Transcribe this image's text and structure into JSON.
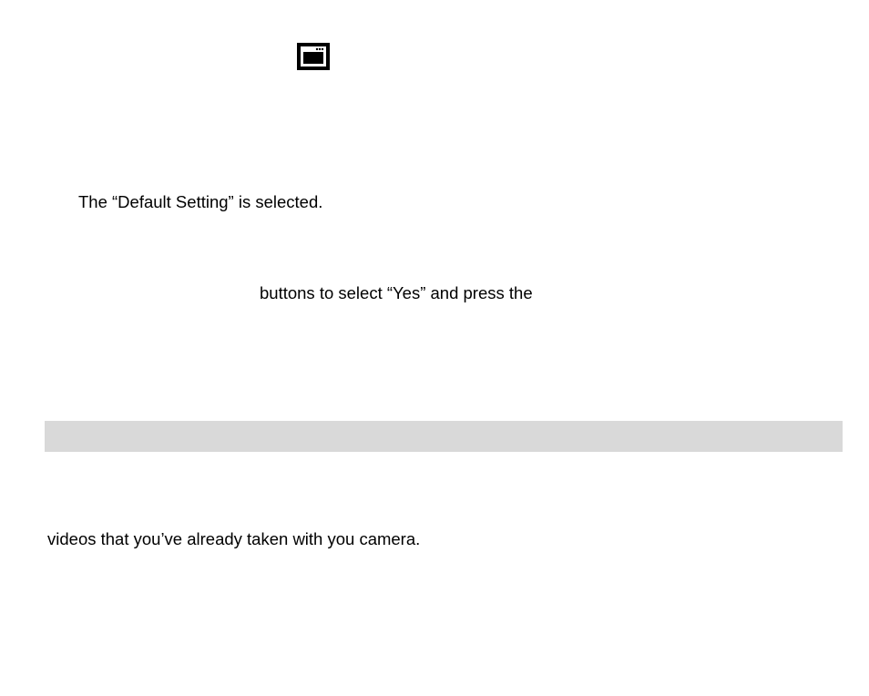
{
  "document": {
    "icon": "kitchen-appliance-icon",
    "text_selected": "The “Default Setting” is selected.",
    "text_buttons": "buttons to select “Yes” and press the",
    "text_videos": "videos that you’ve already taken with you camera."
  },
  "colors": {
    "divider": "#d9d9d9",
    "text": "#000000",
    "background": "#ffffff"
  }
}
